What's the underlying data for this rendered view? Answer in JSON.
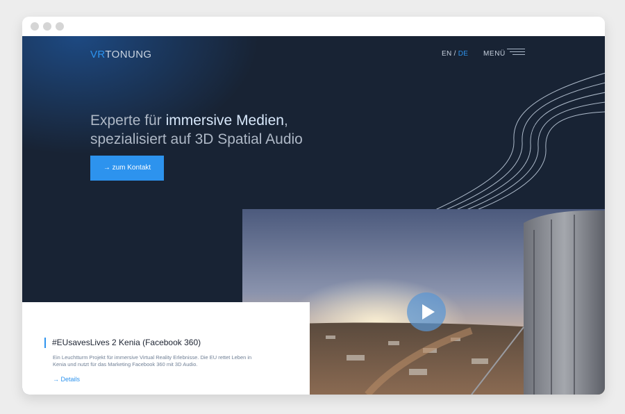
{
  "header": {
    "logo_accent": "VR",
    "logo_rest": "TONUNG",
    "lang_en": "EN",
    "lang_separator": "/",
    "lang_de": "DE",
    "menu_label": "MENÜ"
  },
  "hero": {
    "line1_plain": "Experte für ",
    "line1_highlight": "immersive Medien",
    "line1_end": ",",
    "line2": "spezialisiert auf 3D Spatial Audio",
    "cta_arrow": "→",
    "cta_label": "zum Kontakt"
  },
  "project": {
    "title": "#EUsavesLives 2 Kenia (Facebook 360)",
    "description": "Ein Leuchtturm Projekt für immersive Virtual Reality Erlebnisse. Die EU rettet Leben in Kenia und nutzt für das Marketing Facebook 360 mit 3D Audio.",
    "link_arrow": "→",
    "link_label": "Details"
  },
  "colors": {
    "accent": "#2d93ee",
    "background": "#182334",
    "hero_text": "#aeb8c6",
    "hero_highlight": "#d8e8fb"
  },
  "icons": {
    "play": "play-icon",
    "menu": "hamburger-icon",
    "arrow": "arrow-right-icon"
  }
}
